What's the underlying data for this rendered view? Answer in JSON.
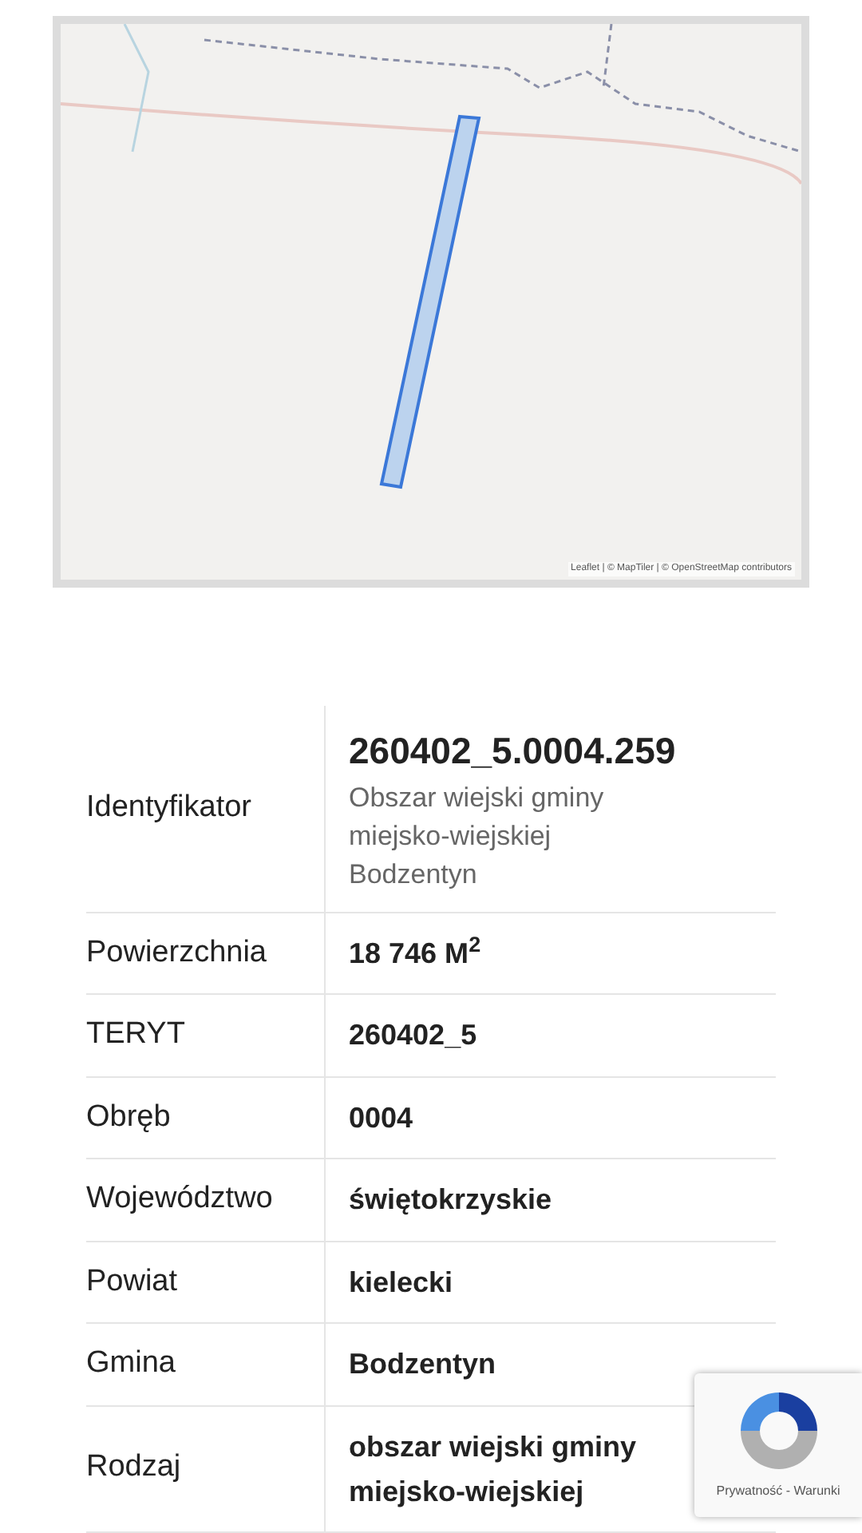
{
  "map": {
    "attribution": "Leaflet | © MapTiler | © OpenStreetMap contributors"
  },
  "table": {
    "rows": [
      {
        "label": "Identyfikator",
        "value": "260402_5.0004.259",
        "subtitle": "Obszar wiejski gminy miejsko-wiejskiej Bodzentyn"
      },
      {
        "label": "Powierzchnia",
        "value": "18 746 M$^{2}$"
      },
      {
        "label": "TERYT",
        "value": "260402_5"
      },
      {
        "label": "Obręb",
        "value": "0004"
      },
      {
        "label": "Województwo",
        "value": "świętokrzyskie"
      },
      {
        "label": "Powiat",
        "value": "kielecki"
      },
      {
        "label": "Gmina",
        "value": "Bodzentyn"
      },
      {
        "label": "Rodzaj",
        "value": "obszar wiejski gminy miejsko-wiejskiej"
      }
    ]
  },
  "recaptcha": {
    "links": "Prywatność - Warunki"
  }
}
